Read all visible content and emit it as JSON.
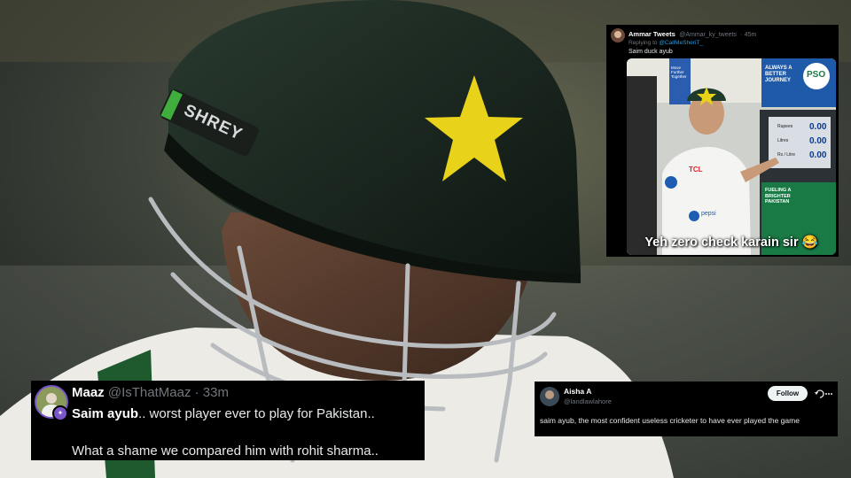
{
  "helmet": {
    "brand": "SHREY"
  },
  "reply_tweet": {
    "name": "Ammar Tweets",
    "handle": "@Ammar_ky_tweets",
    "time": "45m",
    "replying_to_prefix": "Replying to",
    "replying_to_handle": "@CallMeSheriT_",
    "text": "Saim duck ayub",
    "media": {
      "caption": "Yeh zero check karain sir 😂",
      "sign_top": "Move Further Together",
      "sign_right": "ALWAYS A BETTER JOURNEY",
      "sign_pso": "PSO",
      "sign_bottom": "FUELING A BRIGHTER PAKISTAN",
      "pump_labels": [
        "Rupees",
        "Litres",
        "Rs / Litre"
      ],
      "pump_values": [
        "0.00",
        "0.00",
        "0.00"
      ],
      "shirt_sponsor": "TCL",
      "shirt_logo": "pepsi"
    }
  },
  "maaz_tweet": {
    "name": "Maaz",
    "handle": "@IsThatMaaz",
    "separator": "·",
    "time": "33m",
    "line_bold": "Saim ayub",
    "line_rest": ".. worst player ever to play for Pakistan..",
    "line2": "What a shame we compared him with rohit sharma.."
  },
  "aisha_tweet": {
    "name": "Aisha A",
    "handle": "@landlawlahore",
    "follow_label": "Follow",
    "text": "saim ayub, the most confident useless cricketer to have ever played the game"
  },
  "colors": {
    "helmet": "#1c2a23",
    "star": "#e8d21a",
    "tweet_bg": "#000000",
    "link": "#1d9bf0",
    "muted": "#71767b"
  }
}
